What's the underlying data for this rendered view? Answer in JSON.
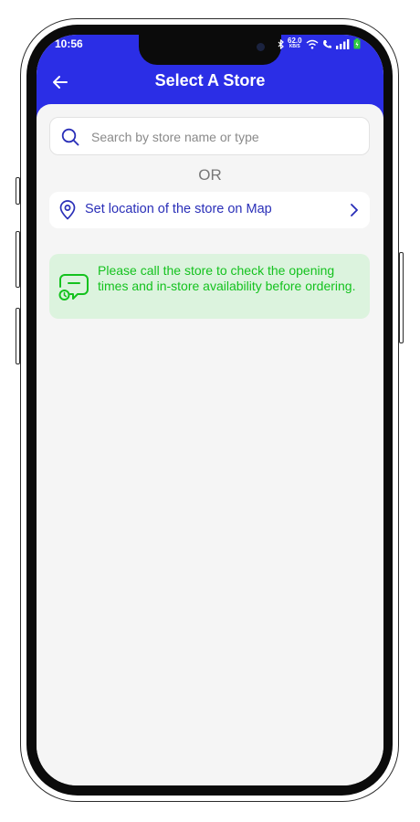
{
  "status_bar": {
    "time": "10:56",
    "net_speed_value": "62.0",
    "net_speed_unit": "KB/S"
  },
  "header": {
    "title": "Select A Store",
    "back_icon": "arrow-left-icon",
    "background_color": "#2b2ee6"
  },
  "search": {
    "placeholder": "Search by store name or type",
    "value": ""
  },
  "divider_text": "OR",
  "map_option": {
    "label": "Set location of the store on Map",
    "icon": "location-pin-icon"
  },
  "notice": {
    "text": "Please call the store to check the opening times and in-store availability before ordering.",
    "icon": "chat-bubble-icon",
    "text_color": "#14c21e",
    "background_color": "#dcf3de"
  }
}
